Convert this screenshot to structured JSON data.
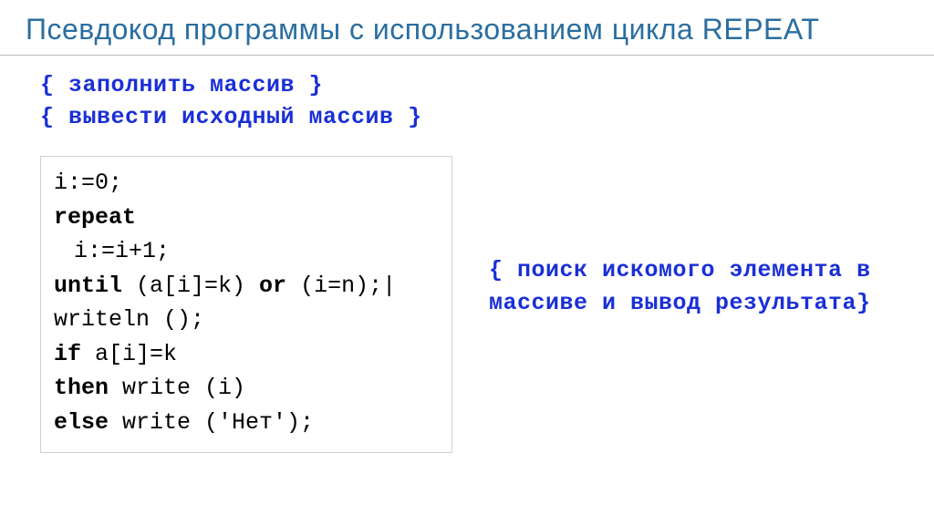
{
  "title": "Псевдокод программы с использованием цикла REPEAT",
  "comments": {
    "fill": "{ заполнить массив }",
    "print": "{ вывести исходный массив }",
    "search": "{ поиск искомого элемента в массиве и вывод результата}"
  },
  "code": {
    "l1": "i:=0;",
    "l2_kw": "repeat",
    "l3": "i:=i+1;",
    "l4_kw1": "until",
    "l4_mid": " (a[i]=k) ",
    "l4_kw2": "or",
    "l4_end": " (i=n);|",
    "l5": "writeln ();",
    "l6_kw": "if",
    "l6_rest": " a[i]=k",
    "l7_kw": "then",
    "l7_rest": " write (i)",
    "l8_kw": "else",
    "l8_rest": " write ('Нет');"
  }
}
